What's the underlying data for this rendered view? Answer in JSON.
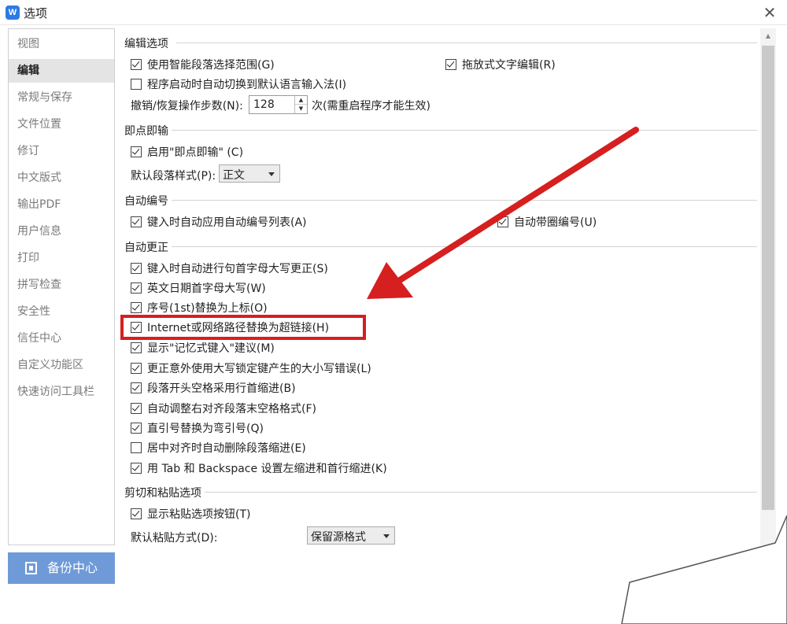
{
  "window": {
    "title": "选项",
    "app_icon": "W",
    "close": "✕"
  },
  "sidebar": {
    "items": [
      {
        "label": "视图"
      },
      {
        "label": "编辑",
        "active": true
      },
      {
        "label": "常规与保存"
      },
      {
        "label": "文件位置"
      },
      {
        "label": "修订"
      },
      {
        "label": "中文版式"
      },
      {
        "label": "输出PDF"
      },
      {
        "label": "用户信息"
      },
      {
        "label": "打印"
      },
      {
        "label": "拼写检查"
      },
      {
        "label": "安全性"
      },
      {
        "label": "信任中心"
      },
      {
        "label": "自定义功能区"
      },
      {
        "label": "快速访问工具栏"
      }
    ]
  },
  "backup": {
    "label": "备份中心"
  },
  "edit_options": {
    "title": "编辑选项",
    "smart_paragraph": "使用智能段落选择范围(G)",
    "drag_edit": "拖放式文字编辑(R)",
    "auto_ime": "程序启动时自动切换到默认语言输入法(I)",
    "undo_label": "撤销/恢复操作步数(N):",
    "undo_value": "128",
    "undo_note": "次(需重启程序才能生效)"
  },
  "click_type": {
    "title": "即点即输",
    "enable": "启用\"即点即输\" (C)",
    "style_label": "默认段落样式(P):",
    "style_value": "正文"
  },
  "auto_number": {
    "title": "自动编号",
    "auto_list": "键入时自动应用自动编号列表(A)",
    "auto_circle": "自动带圈编号(U)"
  },
  "auto_correct": {
    "title": "自动更正",
    "items": [
      "键入时自动进行句首字母大写更正(S)",
      "英文日期首字母大写(W)",
      "序号(1st)替换为上标(O)",
      "Internet或网络路径替换为超链接(H)",
      "显示\"记忆式键入\"建议(M)",
      "更正意外使用大写锁定键产生的大小写错误(L)",
      "段落开头空格采用行首缩进(B)",
      "自动调整右对齐段落末空格格式(F)",
      "直引号替换为弯引号(Q)",
      "居中对齐时自动删除段落缩进(E)",
      "用 Tab 和 Backspace 设置左缩进和首行缩进(K)"
    ]
  },
  "paste": {
    "title": "剪切和粘贴选项",
    "show_button": "显示粘贴选项按钮(T)",
    "default_label": "默认粘贴方式(D):",
    "default_value": "保留源格式"
  },
  "colors": {
    "highlight": "#d61f1f",
    "backup_bg": "#6f9ad8",
    "accent": "#2e7be0"
  }
}
